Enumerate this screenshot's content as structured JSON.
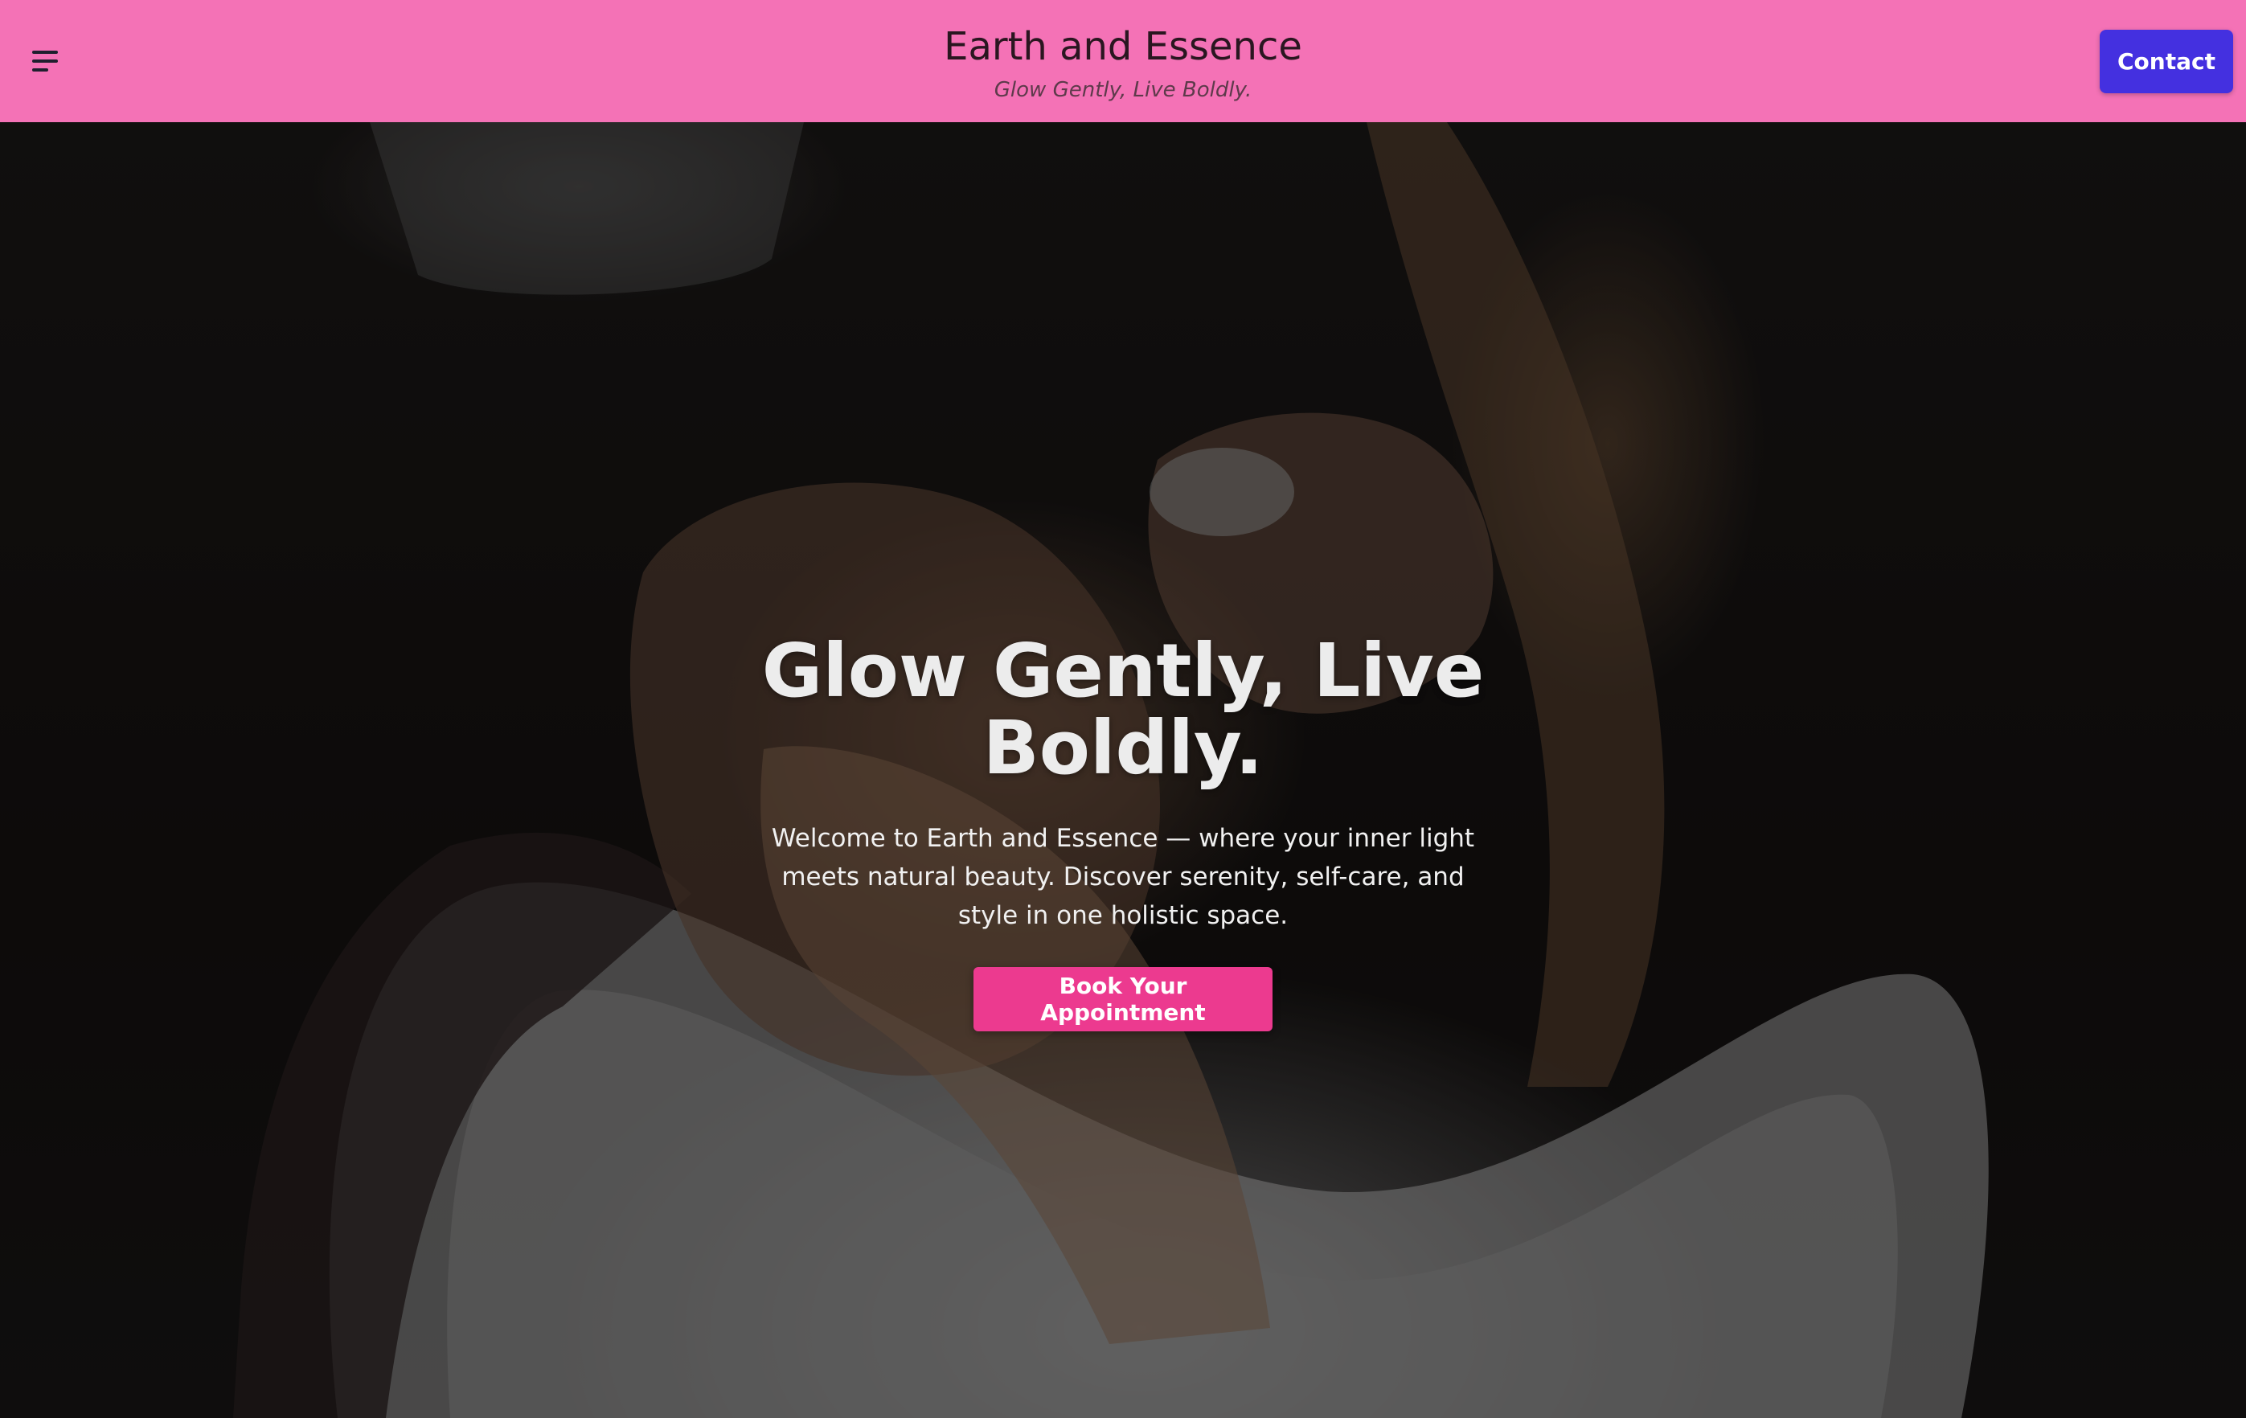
{
  "header": {
    "title": "Earth and Essence",
    "tagline": "Glow Gently, Live Boldly.",
    "contact_label": "Contact",
    "menu_icon": "hamburger-menu-icon"
  },
  "hero": {
    "title": "Glow Gently, Live Boldly.",
    "description": "Welcome to Earth and Essence — where your inner light meets natural beauty. Discover serenity, self-care, and style in one holistic space.",
    "cta_label": "Book Your Appointment"
  },
  "colors": {
    "header_bg": "#f472b6",
    "contact_bg": "#4430e0",
    "cta_bg": "#ec3a8f"
  }
}
